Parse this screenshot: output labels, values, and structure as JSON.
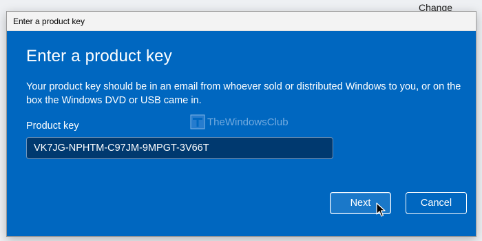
{
  "background": {
    "change_label": "Change"
  },
  "dialog": {
    "window_title": "Enter a product key",
    "heading": "Enter a product key",
    "description": "Your product key should be in an email from whoever sold or distributed Windows to you, or on the box the Windows DVD or USB came in.",
    "field_label": "Product key",
    "product_key_value": "VK7JG-NPHTM-C97JM-9MPGT-3V66T",
    "watermark": "TheWindowsClub",
    "next_label": "Next",
    "cancel_label": "Cancel"
  },
  "colors": {
    "dialog_background": "#0067c0",
    "input_background": "#00396f",
    "titlebar_background": "#f3f3f3"
  },
  "icons": {
    "watermark_logo": "windows-club-logo-icon",
    "cursor": "mouse-pointer-icon"
  }
}
